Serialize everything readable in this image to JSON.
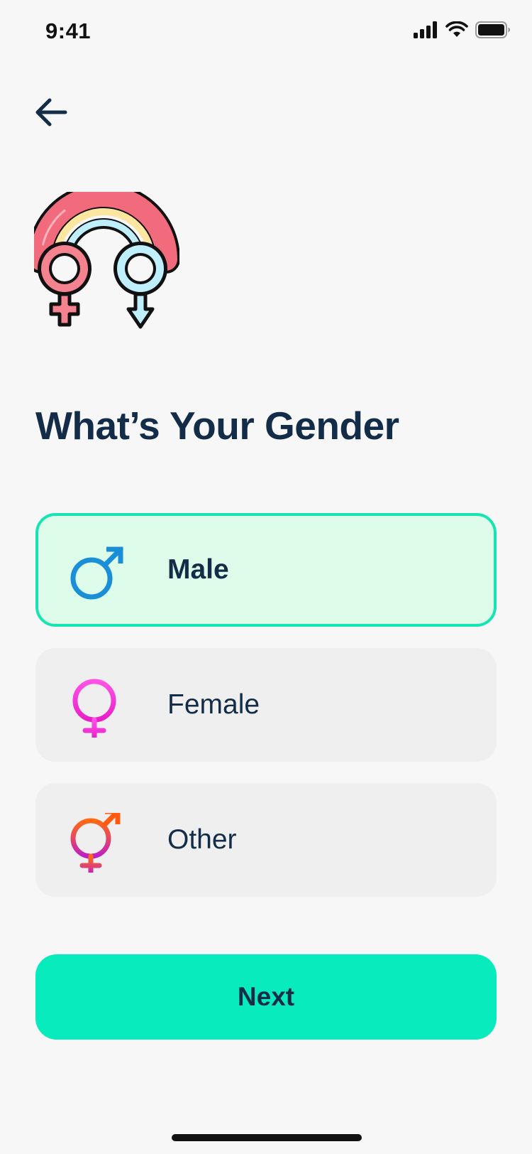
{
  "status_bar": {
    "time": "9:41",
    "icons": [
      "cellular-signal-icon",
      "wifi-icon",
      "battery-icon"
    ]
  },
  "nav": {
    "back_icon": "arrow-left-icon"
  },
  "illustration": {
    "icon": "rainbow-gender-symbols-illustration"
  },
  "title": "What’s Your Gender",
  "options": [
    {
      "label": "Male",
      "icon": "male-symbol-icon",
      "selected": true,
      "icon_color": "#1a8fd8"
    },
    {
      "label": "Female",
      "icon": "female-symbol-icon",
      "selected": false,
      "icon_color": "#ff4fd8"
    },
    {
      "label": "Other",
      "icon": "other-gender-symbol-icon",
      "selected": false,
      "icon_color": "#f05a28"
    }
  ],
  "next_button": {
    "label": "Next"
  },
  "colors": {
    "background": "#f7f7f8",
    "text": "#132c48",
    "accent": "#07ebbd",
    "selected_border": "#17e4b3",
    "selected_fill": "#ddfce9",
    "option_fill": "#efeff0"
  }
}
